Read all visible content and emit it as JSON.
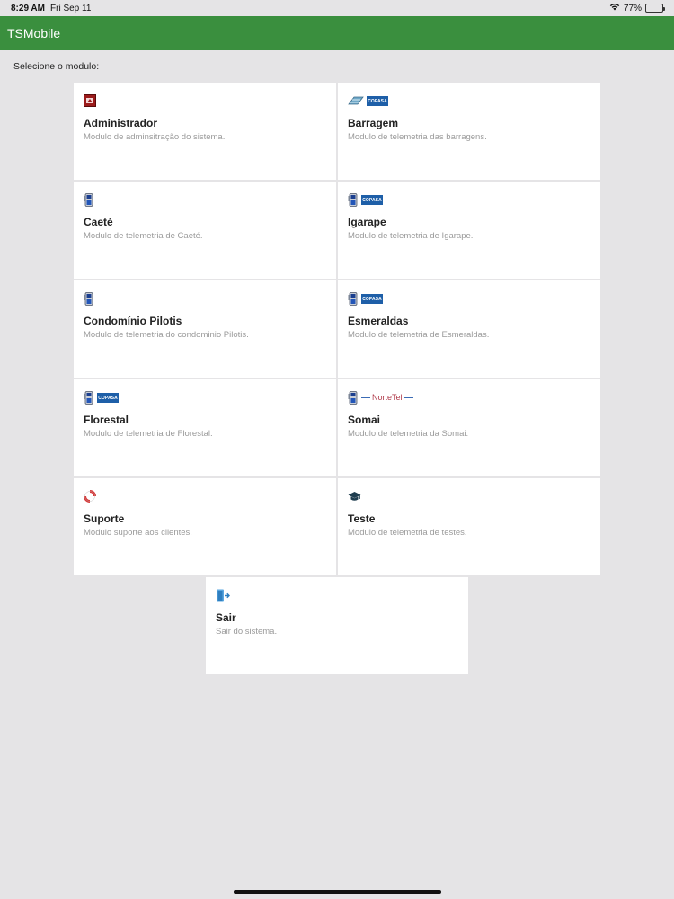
{
  "status_bar": {
    "time": "8:29 AM",
    "date": "Fri Sep 11",
    "battery": "77%",
    "battery_level": 0.77
  },
  "app": {
    "title": "TSMobile"
  },
  "prompt": "Selecione o modulo:",
  "modules": [
    {
      "id": "administrador",
      "title": "Administrador",
      "desc": "Modulo de adminsitração do sistema.",
      "icons": [
        "admin-icon"
      ]
    },
    {
      "id": "barragem",
      "title": "Barragem",
      "desc": "Modulo de telemetria das barragens.",
      "icons": [
        "dam-icon",
        "copasa-logo"
      ]
    },
    {
      "id": "caete",
      "title": "Caeté",
      "desc": "Modulo de telemetria de Caeté.",
      "icons": [
        "telemetry-device-icon"
      ]
    },
    {
      "id": "igarape",
      "title": "Igarape",
      "desc": "Modulo de telemetria de Igarape.",
      "icons": [
        "telemetry-device-icon",
        "copasa-logo"
      ]
    },
    {
      "id": "condominio-pilotis",
      "title": "Condomínio Pilotis",
      "desc": "Modulo de telemetria do condominio Pilotis.",
      "icons": [
        "telemetry-device-icon"
      ]
    },
    {
      "id": "esmeraldas",
      "title": "Esmeraldas",
      "desc": "Modulo de telemetria de Esmeraldas.",
      "icons": [
        "telemetry-device-icon",
        "copasa-logo"
      ]
    },
    {
      "id": "florestal",
      "title": "Florestal",
      "desc": "Modulo de telemetria de Florestal.",
      "icons": [
        "telemetry-device-icon",
        "copasa-logo"
      ]
    },
    {
      "id": "somai",
      "title": "Somai",
      "desc": "Modulo de telemetria da Somai.",
      "icons": [
        "telemetry-device-icon",
        "nortetel-logo"
      ]
    },
    {
      "id": "suporte",
      "title": "Suporte",
      "desc": "Modulo suporte aos clientes.",
      "icons": [
        "lifebuoy-icon"
      ]
    },
    {
      "id": "teste",
      "title": "Teste",
      "desc": "Modulo de telemetria de testes.",
      "icons": [
        "graduation-cap-icon"
      ]
    },
    {
      "id": "sair",
      "title": "Sair",
      "desc": "Sair do sistema.",
      "icons": [
        "exit-icon"
      ]
    }
  ],
  "logos": {
    "copasa": "COPASA",
    "nortetel": "NorteTel"
  },
  "colors": {
    "appbar": "#3a8f3e",
    "background": "#e5e4e6",
    "card": "#ffffff",
    "copasa_blue": "#1e5fa8"
  }
}
